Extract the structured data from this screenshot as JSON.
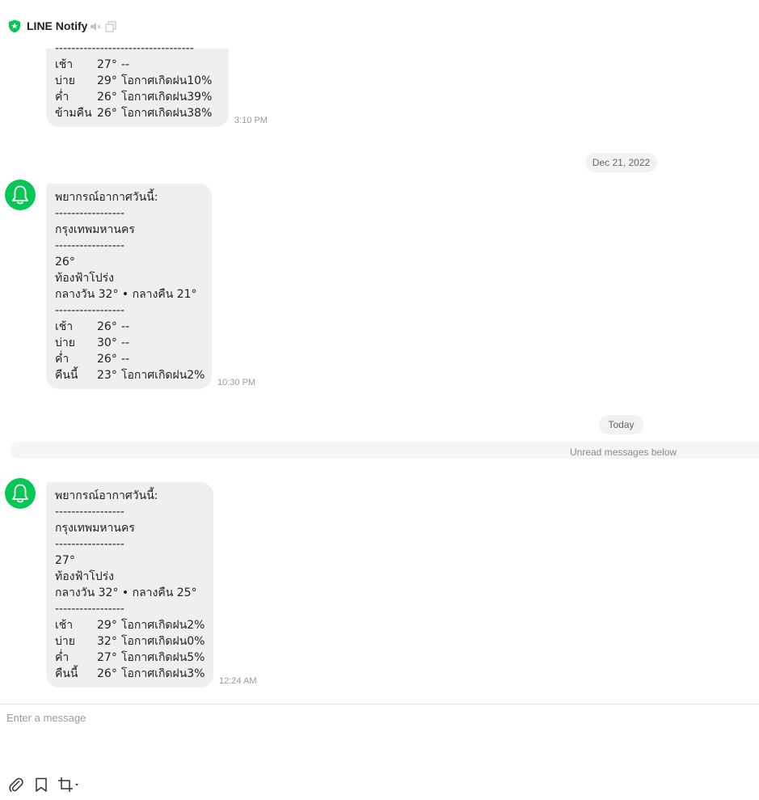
{
  "header": {
    "title": "LINE Notify",
    "icons": [
      "shield-star-icon",
      "speaker-mute-icon",
      "popout-window-icon"
    ]
  },
  "partial_message": {
    "divider": "----------------------------------",
    "rows": [
      {
        "label": "เช้า",
        "temp": "27°",
        "rain": "--"
      },
      {
        "label": "บ่าย",
        "temp": "29°",
        "rain": "โอกาศเกิดฝน10%"
      },
      {
        "label": "ค่ำ",
        "temp": "26°",
        "rain": "โอกาศเกิดฝน39%"
      },
      {
        "label": "ข้ามคืน",
        "temp": "26°",
        "rain": "โอกาศเกิดฝน38%"
      }
    ],
    "time": "3:10 PM"
  },
  "date_dec21": "Dec 21, 2022",
  "message_1": {
    "heading": "พยากรณ์อากาศวันนี้:",
    "divider": "-----------------",
    "city": "กรุงเทพมหานคร",
    "current_temp": "26°",
    "condition": "ท้องฟ้าโปร่ง",
    "day_night": "กลางวัน 32° • กลางคืน 21°",
    "rows": [
      {
        "label": "เช้า",
        "temp": "26°",
        "rain": "--"
      },
      {
        "label": "บ่าย",
        "temp": "30°",
        "rain": "--"
      },
      {
        "label": "ค่ำ",
        "temp": "26°",
        "rain": "--"
      },
      {
        "label": "คืนนี้",
        "temp": "23°",
        "rain": "โอกาศเกิดฝน2%"
      }
    ],
    "time": "10:30 PM"
  },
  "date_today": "Today",
  "unread_label": "Unread messages below",
  "message_2": {
    "heading": "พยากรณ์อากาศวันนี้:",
    "divider": "-----------------",
    "city": "กรุงเทพมหานคร",
    "current_temp": "27°",
    "condition": "ท้องฟ้าโปร่ง",
    "day_night": "กลางวัน 32° • กลางคืน 25°",
    "rows": [
      {
        "label": "เช้า",
        "temp": "29°",
        "rain": "โอกาศเกิดฝน2%"
      },
      {
        "label": "บ่าย",
        "temp": "32°",
        "rain": "โอกาศเกิดฝน0%"
      },
      {
        "label": "ค่ำ",
        "temp": "27°",
        "rain": "โอกาศเกิดฝน5%"
      },
      {
        "label": "คืนนี้",
        "temp": "26°",
        "rain": "โอกาศเกิดฝน3%"
      }
    ],
    "time": "12:24 AM"
  },
  "composer": {
    "placeholder": "Enter a message",
    "tools": [
      "paperclip-icon",
      "bookmark-icon",
      "crop-icon"
    ]
  },
  "colors": {
    "brand_green": "#06C755",
    "bubble_bg": "#EFEFEF"
  }
}
